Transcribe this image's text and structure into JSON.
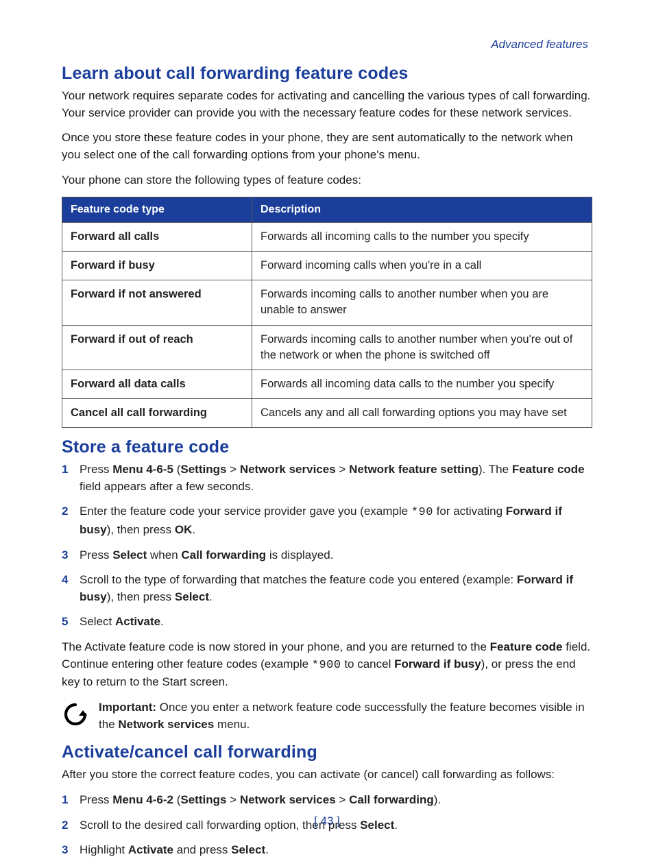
{
  "header": {
    "section_label": "Advanced features"
  },
  "s1": {
    "title": "Learn about call forwarding feature codes",
    "p1": "Your network requires separate codes for activating and cancelling the various types of call forwarding. Your service provider can provide you with the necessary feature codes for these network services.",
    "p2": "Once you store these feature codes in your phone, they are sent automatically to the network when you select one of the call forwarding options from your phone's menu.",
    "p3": "Your phone can store the following types of feature codes:"
  },
  "table": {
    "head": {
      "c1": "Feature code type",
      "c2": "Description"
    },
    "rows": [
      {
        "type": "Forward all calls",
        "desc": "Forwards all incoming calls to the number you specify"
      },
      {
        "type": "Forward if busy",
        "desc": "Forward incoming calls when you're in a call"
      },
      {
        "type": "Forward if not answered",
        "desc": "Forwards incoming calls to another number when you are unable to answer"
      },
      {
        "type": "Forward if out of reach",
        "desc": "Forwards incoming calls to another number when you're out of the network or when the phone is switched off"
      },
      {
        "type": "Forward all data calls",
        "desc": "Forwards all incoming data calls to the number you specify"
      },
      {
        "type": "Cancel all call forwarding",
        "desc": "Cancels any and all call forwarding options you may have set"
      }
    ]
  },
  "s2": {
    "title": "Store a feature code",
    "steps": {
      "i1": {
        "a": "Press ",
        "b": "Menu 4-6-5",
        "c": " (",
        "d": "Settings",
        "e": " > ",
        "f": "Network services",
        "g": " > ",
        "h": "Network feature setting",
        "i": "). The ",
        "j": "Feature code",
        "k": " field appears after a few seconds."
      },
      "i2": {
        "a": "Enter the feature code your service provider gave you (example ",
        "b": "*90",
        "c": " for activating ",
        "d": "Forward if busy",
        "e": "), then press ",
        "f": "OK",
        "g": "."
      },
      "i3": {
        "a": "Press ",
        "b": "Select",
        "c": " when ",
        "d": "Call forwarding",
        "e": " is displayed."
      },
      "i4": {
        "a": "Scroll to the type of forwarding that matches the feature code you entered (example: ",
        "b": "Forward if busy",
        "c": "), then press ",
        "d": "Select",
        "e": "."
      },
      "i5": {
        "a": "Select ",
        "b": "Activate",
        "c": "."
      }
    },
    "after": {
      "a": "The Activate feature code is now stored in your phone, and you are returned to the ",
      "b": "Feature code",
      "c": " field. Continue entering other feature codes (example ",
      "d": "*900",
      "e": " to cancel ",
      "f": "Forward if busy",
      "g": "), or press the end key to return to the Start screen."
    },
    "note": {
      "label": "Important:",
      "a": " Once you enter a network feature code successfully the feature becomes visible in the ",
      "b": "Network services",
      "c": " menu."
    }
  },
  "s3": {
    "title": "Activate/cancel call forwarding",
    "p1": "After you store the correct feature codes, you can activate (or cancel) call forwarding as follows:",
    "steps": {
      "i1": {
        "a": "Press ",
        "b": "Menu 4-6-2",
        "c": " (",
        "d": "Settings",
        "e": " > ",
        "f": "Network services",
        "g": " > ",
        "h": "Call forwarding",
        "i": ")."
      },
      "i2": {
        "a": "Scroll to the desired call forwarding option, then press ",
        "b": "Select",
        "c": "."
      },
      "i3": {
        "a": "Highlight ",
        "b": "Activate",
        "c": " and press ",
        "d": "Select",
        "e": "."
      }
    }
  },
  "footer": {
    "page": "[ 43 ]"
  }
}
